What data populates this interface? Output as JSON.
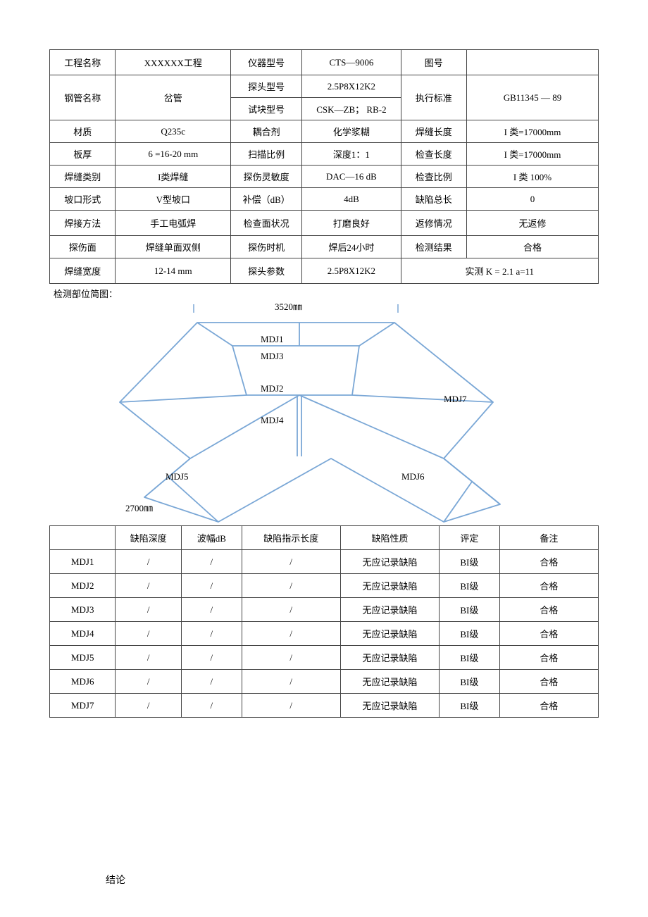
{
  "top": {
    "rows": [
      {
        "c1": "工程名称",
        "c2": "XXXXXX工程",
        "c3": "仪器型号",
        "c4": "CTS—9006",
        "c5": "图号",
        "c6": ""
      },
      {
        "c1": "钢管名称",
        "c2": "岔管",
        "c3a": "探头型号",
        "c4a": "2.5P8X12K2",
        "c3b": "试块型号",
        "c4b": "CSK—ZB；  RB-2",
        "c5": "执行标准",
        "c6": "GB11345 — 89"
      },
      {
        "c1": "材质",
        "c2": "Q235c",
        "c3": "耦合剂",
        "c4": "化学浆糊",
        "c5": "焊缝长度",
        "c6": "I 类=17000mm"
      },
      {
        "c1": "板厚",
        "c2": "6 =16-20 mm",
        "c3": "扫描比例",
        "c4": "深度1：1",
        "c5": "检查长度",
        "c6": "I 类=17000mm"
      },
      {
        "c1": "焊缝类别",
        "c2": "I类焊缝",
        "c3": "探伤灵敏度",
        "c4": "DAC—16 dB",
        "c5": "检查比例",
        "c6": "I 类 100%"
      },
      {
        "c1": "坡口形式",
        "c2": "V型坡口",
        "c3": "补偿（dB）",
        "c4": "4dB",
        "c5": "缺陷总长",
        "c6": "0"
      },
      {
        "c1": "焊接方法",
        "c2": "手工电弧焊",
        "c3": "检查面状况",
        "c4": "打磨良好",
        "c5": "返修情况",
        "c6": "无返修"
      },
      {
        "c1": "探伤面",
        "c2": "焊缝单面双侧",
        "c3": "探伤时机",
        "c4": "焊后24小时",
        "c5": "检测结果",
        "c6": "合格"
      },
      {
        "c1": "焊缝宽度",
        "c2": "12-14 mm",
        "c3": "探头参数",
        "c4": "2.5P8X12K2",
        "c56": "实测 K = 2.1    a=11"
      }
    ]
  },
  "diagram": {
    "label": "检测部位简图：",
    "dim_top": "3520㎜",
    "dim_left": "2700㎜",
    "labels": {
      "m1": "MDJ1",
      "m2": "MDJ2",
      "m3": "MDJ3",
      "m4": "MDJ4",
      "m5": "MDJ5",
      "m6": "MDJ6",
      "m7": "MDJ7"
    }
  },
  "results": {
    "headers": {
      "h0": "",
      "h1": "缺陷深度",
      "h2": "波幅dB",
      "h3": "缺陷指示长度",
      "h4": "缺陷性质",
      "h5": "评定",
      "h6": "备注"
    },
    "rows": [
      {
        "id": "MDJ1",
        "d": "/",
        "a": "/",
        "l": "/",
        "n": "无应记录缺陷",
        "g": "BI级",
        "r": "合格"
      },
      {
        "id": "MDJ2",
        "d": "/",
        "a": "/",
        "l": "/",
        "n": "无应记录缺陷",
        "g": "BI级",
        "r": "合格"
      },
      {
        "id": "MDJ3",
        "d": "/",
        "a": "/",
        "l": "/",
        "n": "无应记录缺陷",
        "g": "BI级",
        "r": "合格"
      },
      {
        "id": "MDJ4",
        "d": "/",
        "a": "/",
        "l": "/",
        "n": "无应记录缺陷",
        "g": "BI级",
        "r": "合格"
      },
      {
        "id": "MDJ5",
        "d": "/",
        "a": "/",
        "l": "/",
        "n": "无应记录缺陷",
        "g": "BI级",
        "r": "合格"
      },
      {
        "id": "MDJ6",
        "d": "/",
        "a": "/",
        "l": "/",
        "n": "无应记录缺陷",
        "g": "BI级",
        "r": "合格"
      },
      {
        "id": "MDJ7",
        "d": "/",
        "a": "/",
        "l": "/",
        "n": "无应记录缺陷",
        "g": "BI级",
        "r": "合格"
      }
    ]
  },
  "conclusion_label": "结论"
}
